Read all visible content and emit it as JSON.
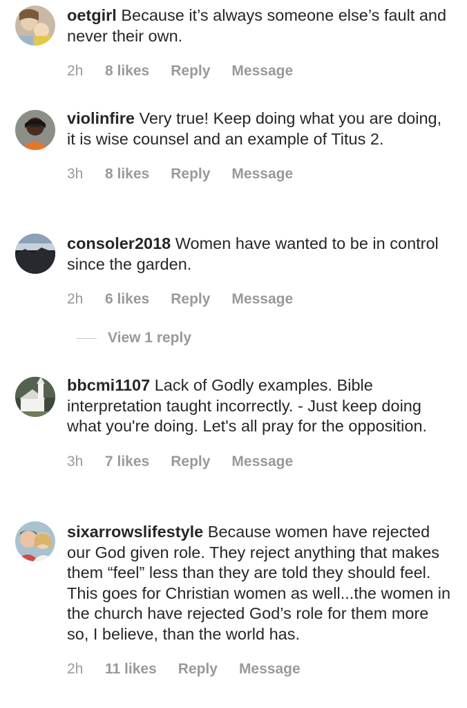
{
  "comments": [
    {
      "username": "oetgirl",
      "text": "Because it’s always someone else’s fault and never their own.",
      "time": "2h",
      "likes": "8 likes",
      "reply": "Reply",
      "message": "Message",
      "avatar": "woman-with-baby-photo"
    },
    {
      "username": "violinfire",
      "text": "Very true! Keep doing what you are doing, it is wise counsel and an example of Titus 2.",
      "time": "3h",
      "likes": "8 likes",
      "reply": "Reply",
      "message": "Message",
      "avatar": "woman-orange-shirt-photo"
    },
    {
      "username": "consoler2018",
      "text": "Women have wanted to be in control since the garden.",
      "time": "2h",
      "likes": "6 likes",
      "reply": "Reply",
      "message": "Message",
      "avatar": "mountain-landscape-photo"
    },
    {
      "username": "bbcmi1107",
      "text": "Lack of Godly examples. Bible interpretation taught incorrectly. - Just keep doing what you're doing. Let's all pray for the opposition.",
      "time": "3h",
      "likes": "7 likes",
      "reply": "Reply",
      "message": "Message",
      "avatar": "white-church-photo"
    },
    {
      "username": "sixarrowslifestyle",
      "text": "Because women have rejected our God given role. They reject anything that makes them “feel” less than they are told they should feel. This goes for Christian women as well...the women in the church have rejected God’s role for them more so, I believe, than the world has.",
      "time": "2h",
      "likes": "11 likes",
      "reply": "Reply",
      "message": "Message",
      "avatar": "two-women-photo"
    }
  ],
  "view_replies": "View 1 reply"
}
